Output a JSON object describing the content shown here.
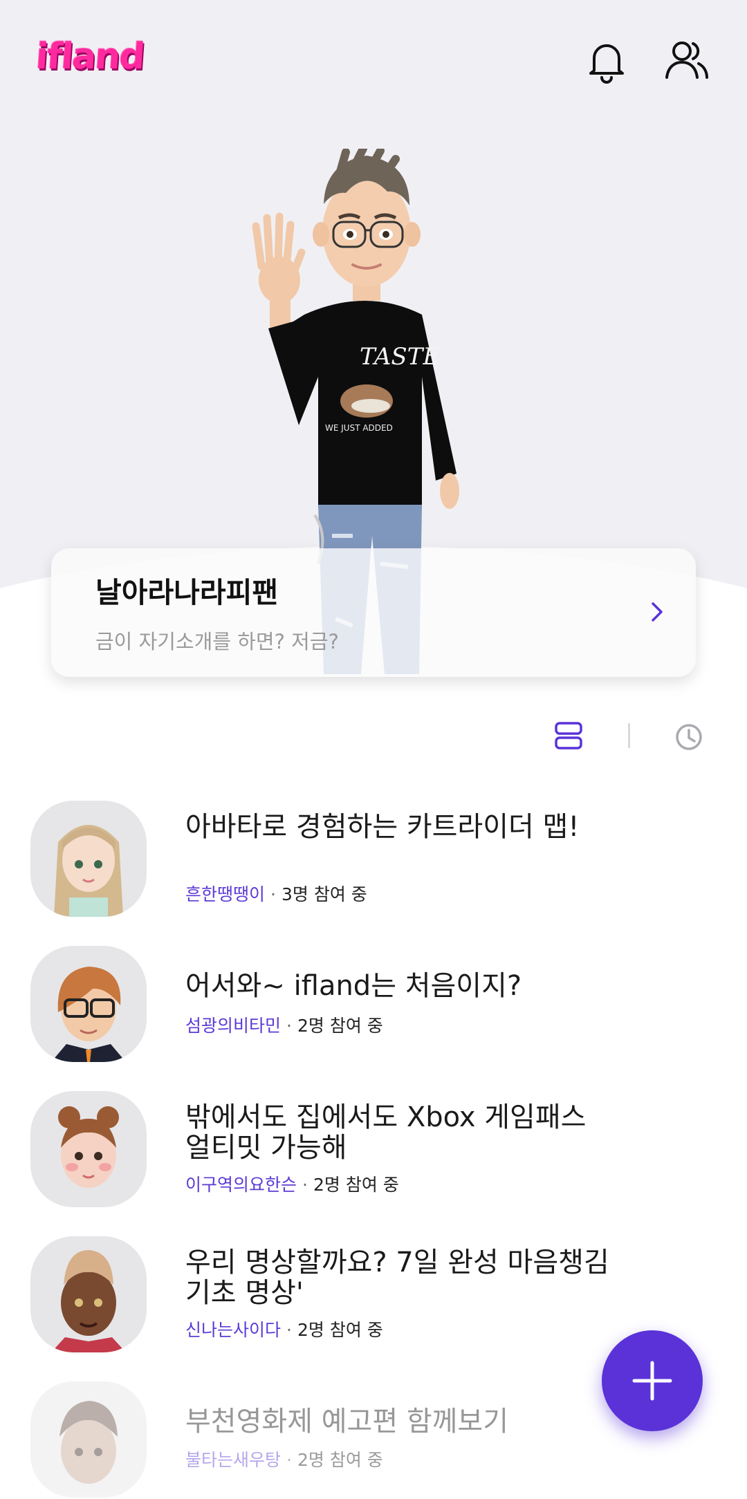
{
  "header": {
    "logo_text": "ifland",
    "notification_icon": "bell-icon",
    "friends_icon": "friends-icon"
  },
  "profile": {
    "name": "날아라나라피팬",
    "bio_placeholder": "금이 자기소개를 하면? 저금?"
  },
  "list_controls": {
    "view_icon": "list-view-icon",
    "history_icon": "clock-icon"
  },
  "rooms": [
    {
      "title": "아바타로 경험하는 카트라이더 맵!",
      "host": "흔한땡땡이",
      "participants": "3명 참여 중"
    },
    {
      "title": "어서와~ ifland는 처음이지?",
      "host": "섬광의비타민",
      "participants": "2명 참여 중"
    },
    {
      "title": "밖에서도 집에서도 Xbox 게임패스 얼티밋 가능해",
      "host": "이구역의요한슨",
      "participants": "2명 참여 중"
    },
    {
      "title": "우리 명상할까요? 7일 완성 마음챙김 기초 명상'",
      "host": "신나는사이다",
      "participants": "2명 참여 중"
    },
    {
      "title": "부천영화제 예고편 함께보기",
      "host": "불타는새우탕",
      "participants": "2명 참여 중"
    }
  ],
  "fab": {
    "icon": "plus-icon"
  },
  "colors": {
    "accent": "#5a32d8",
    "brand": "#ff2a9e",
    "host_text": "#5c3ad6"
  }
}
